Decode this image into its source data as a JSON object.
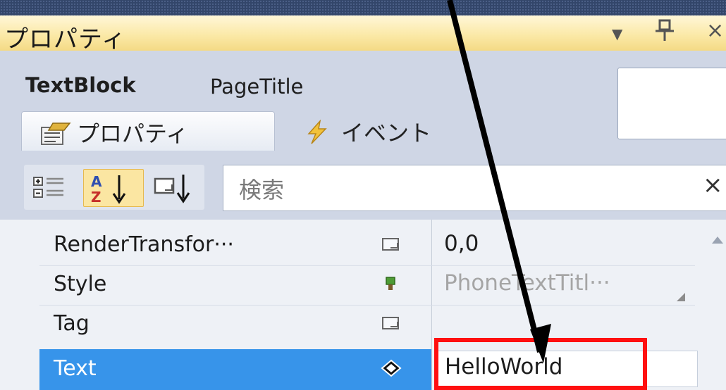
{
  "window": {
    "title": "プロパティ"
  },
  "selected_object": {
    "type": "TextBlock",
    "name": "PageTitle"
  },
  "tabs": [
    {
      "label": "プロパティ",
      "icon": "properties-icon",
      "active": true
    },
    {
      "label": "イベント",
      "icon": "lightning-icon",
      "active": false
    }
  ],
  "toolbar": {
    "search_placeholder": "検索",
    "clear_label": "×",
    "sort_mode": "alphabetical"
  },
  "properties": [
    {
      "name": "RenderTransfor···",
      "marker": "local-value-marker",
      "value": "0,0"
    },
    {
      "name": "Style",
      "marker": "resource-marker",
      "value": "PhoneTextTitl···"
    },
    {
      "name": "Tag",
      "marker": "local-value-marker",
      "value": ""
    },
    {
      "name": "Text",
      "marker": "diamond-marker",
      "value": "HelloWorld",
      "selected": true
    }
  ],
  "colors": {
    "accent_selected": "#3794ea",
    "annotation": "#ff1010",
    "title_bar": "#fbe9a8"
  }
}
